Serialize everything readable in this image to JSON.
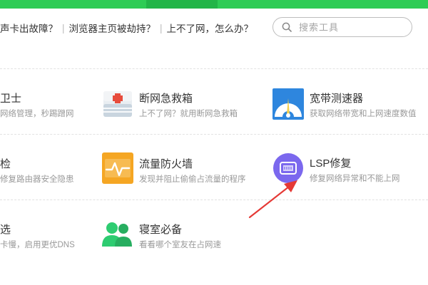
{
  "topbar": {},
  "quicklinks": [
    "声卡出故障？",
    "浏览器主页被劫持？",
    "上不了网，怎么办？"
  ],
  "search": {
    "placeholder": "搜索工具"
  },
  "tools": [
    {
      "title": "卫士",
      "desc": "网络管理，秒踢蹭网",
      "icon": "shield-icon"
    },
    {
      "title": "断网急救箱",
      "desc": "上不了网？就用断网急救箱",
      "icon": "first-aid-kit-icon"
    },
    {
      "title": "宽带测速器",
      "desc": "获取网络带宽和上网速度数值",
      "icon": "speedometer-icon"
    },
    {
      "title": "检",
      "desc": "修复路由器安全隐患",
      "icon": "router-check-icon"
    },
    {
      "title": "流量防火墙",
      "desc": "发现并阻止偷偷占流量的程序",
      "icon": "traffic-firewall-icon"
    },
    {
      "title": "LSP修复",
      "desc": "修复网络异常和不能上网",
      "icon": "lsp-repair-icon"
    },
    {
      "title": "选",
      "desc": "卡慢，启用更优DNS",
      "icon": "dns-select-icon"
    },
    {
      "title": "寝室必备",
      "desc": "看看哪个室友在占网速",
      "icon": "roommates-icon"
    }
  ],
  "colors": {
    "brand_green": "#2ecc55",
    "annotation_red": "#e53935",
    "lsp_purple": "#7b68ee",
    "kit_red": "#e74c3c",
    "speed_blue": "#2e86de",
    "firewall_orange": "#f5a623",
    "people_green": "#2ecc71"
  }
}
